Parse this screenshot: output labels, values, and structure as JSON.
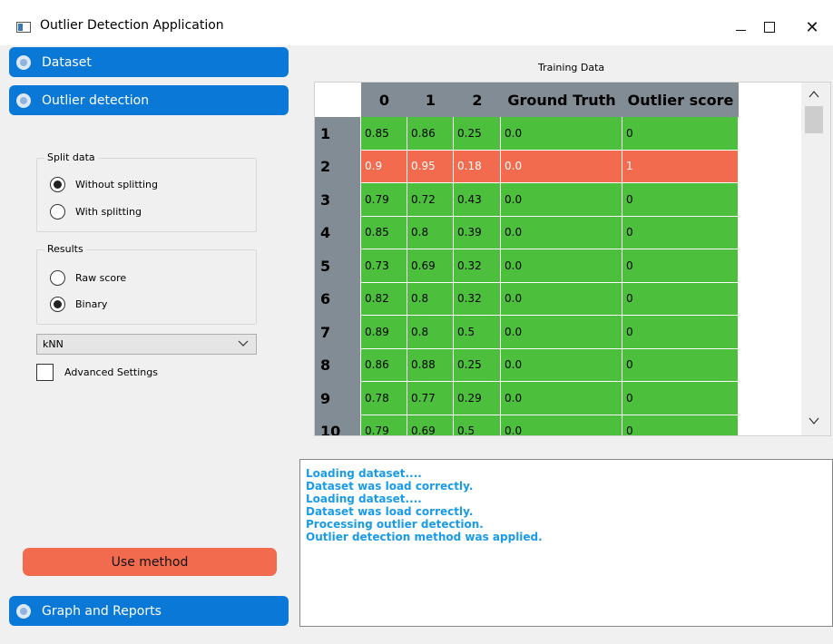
{
  "window": {
    "title": "Outlier Detection Application",
    "min_glyph": "—",
    "max_glyph": "☐",
    "close_glyph": "✕"
  },
  "sections": {
    "dataset": "Dataset",
    "outlier": "Outlier detection",
    "graph": "Graph and Reports"
  },
  "split": {
    "title": "Split data",
    "options": [
      {
        "label": "Without splitting",
        "checked": true
      },
      {
        "label": "With splitting",
        "checked": false
      }
    ]
  },
  "results": {
    "title": "Results",
    "options": [
      {
        "label": "Raw score",
        "checked": false
      },
      {
        "label": "Binary",
        "checked": true
      }
    ]
  },
  "method_select": {
    "value": "kNN"
  },
  "advanced": {
    "label": "Advanced Settings",
    "checked": false
  },
  "use_method": "Use method",
  "table": {
    "caption": "Training Data",
    "headers": [
      "0",
      "1",
      "2",
      "Ground Truth",
      "Outlier score"
    ],
    "rows": [
      {
        "index": "1",
        "cells": [
          "0.85",
          "0.86",
          "0.25",
          "0.0",
          "0"
        ],
        "outlier": false
      },
      {
        "index": "2",
        "cells": [
          "0.9",
          "0.95",
          "0.18",
          "0.0",
          "1"
        ],
        "outlier": true
      },
      {
        "index": "3",
        "cells": [
          "0.79",
          "0.72",
          "0.43",
          "0.0",
          "0"
        ],
        "outlier": false
      },
      {
        "index": "4",
        "cells": [
          "0.85",
          "0.8",
          "0.39",
          "0.0",
          "0"
        ],
        "outlier": false
      },
      {
        "index": "5",
        "cells": [
          "0.73",
          "0.69",
          "0.32",
          "0.0",
          "0"
        ],
        "outlier": false
      },
      {
        "index": "6",
        "cells": [
          "0.82",
          "0.8",
          "0.32",
          "0.0",
          "0"
        ],
        "outlier": false
      },
      {
        "index": "7",
        "cells": [
          "0.89",
          "0.8",
          "0.5",
          "0.0",
          "0"
        ],
        "outlier": false
      },
      {
        "index": "8",
        "cells": [
          "0.86",
          "0.88",
          "0.25",
          "0.0",
          "0"
        ],
        "outlier": false
      },
      {
        "index": "9",
        "cells": [
          "0.78",
          "0.77",
          "0.29",
          "0.0",
          "0"
        ],
        "outlier": false
      },
      {
        "index": "10",
        "cells": [
          "0.79",
          "0.69",
          "0.5",
          "0.0",
          "0"
        ],
        "outlier": false
      }
    ]
  },
  "log": [
    "Loading dataset....",
    "Dataset was load correctly.",
    "Loading dataset....",
    "Dataset was load correctly.",
    "Processing outlier detection.",
    "Outlier detection method was applied."
  ],
  "colors": {
    "accent": "#0a78d7",
    "inlier": "#4cbf3c",
    "outlier": "#f26b4f",
    "header": "#818c95",
    "log_text": "#1a9be8"
  }
}
